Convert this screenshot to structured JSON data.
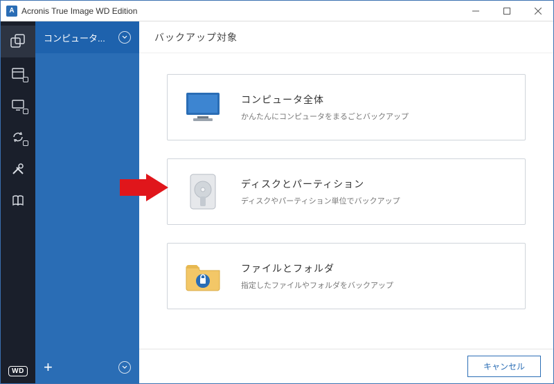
{
  "window": {
    "title": "Acronis True Image WD Edition"
  },
  "sidebar": {
    "wd_label": "WD"
  },
  "panel": {
    "selected_label": "コンピュータ..."
  },
  "main": {
    "header": "バックアップ対象",
    "options": [
      {
        "title": "コンピュータ全体",
        "desc": "かんたんにコンピュータをまるごとバックアップ"
      },
      {
        "title": "ディスクとパーティション",
        "desc": "ディスクやパーティション単位でバックアップ"
      },
      {
        "title": "ファイルとフォルダ",
        "desc": "指定したファイルやフォルダをバックアップ"
      }
    ],
    "cancel": "キャンセル"
  },
  "colors": {
    "accent": "#2a6db5",
    "arrow": "#e0161b"
  }
}
